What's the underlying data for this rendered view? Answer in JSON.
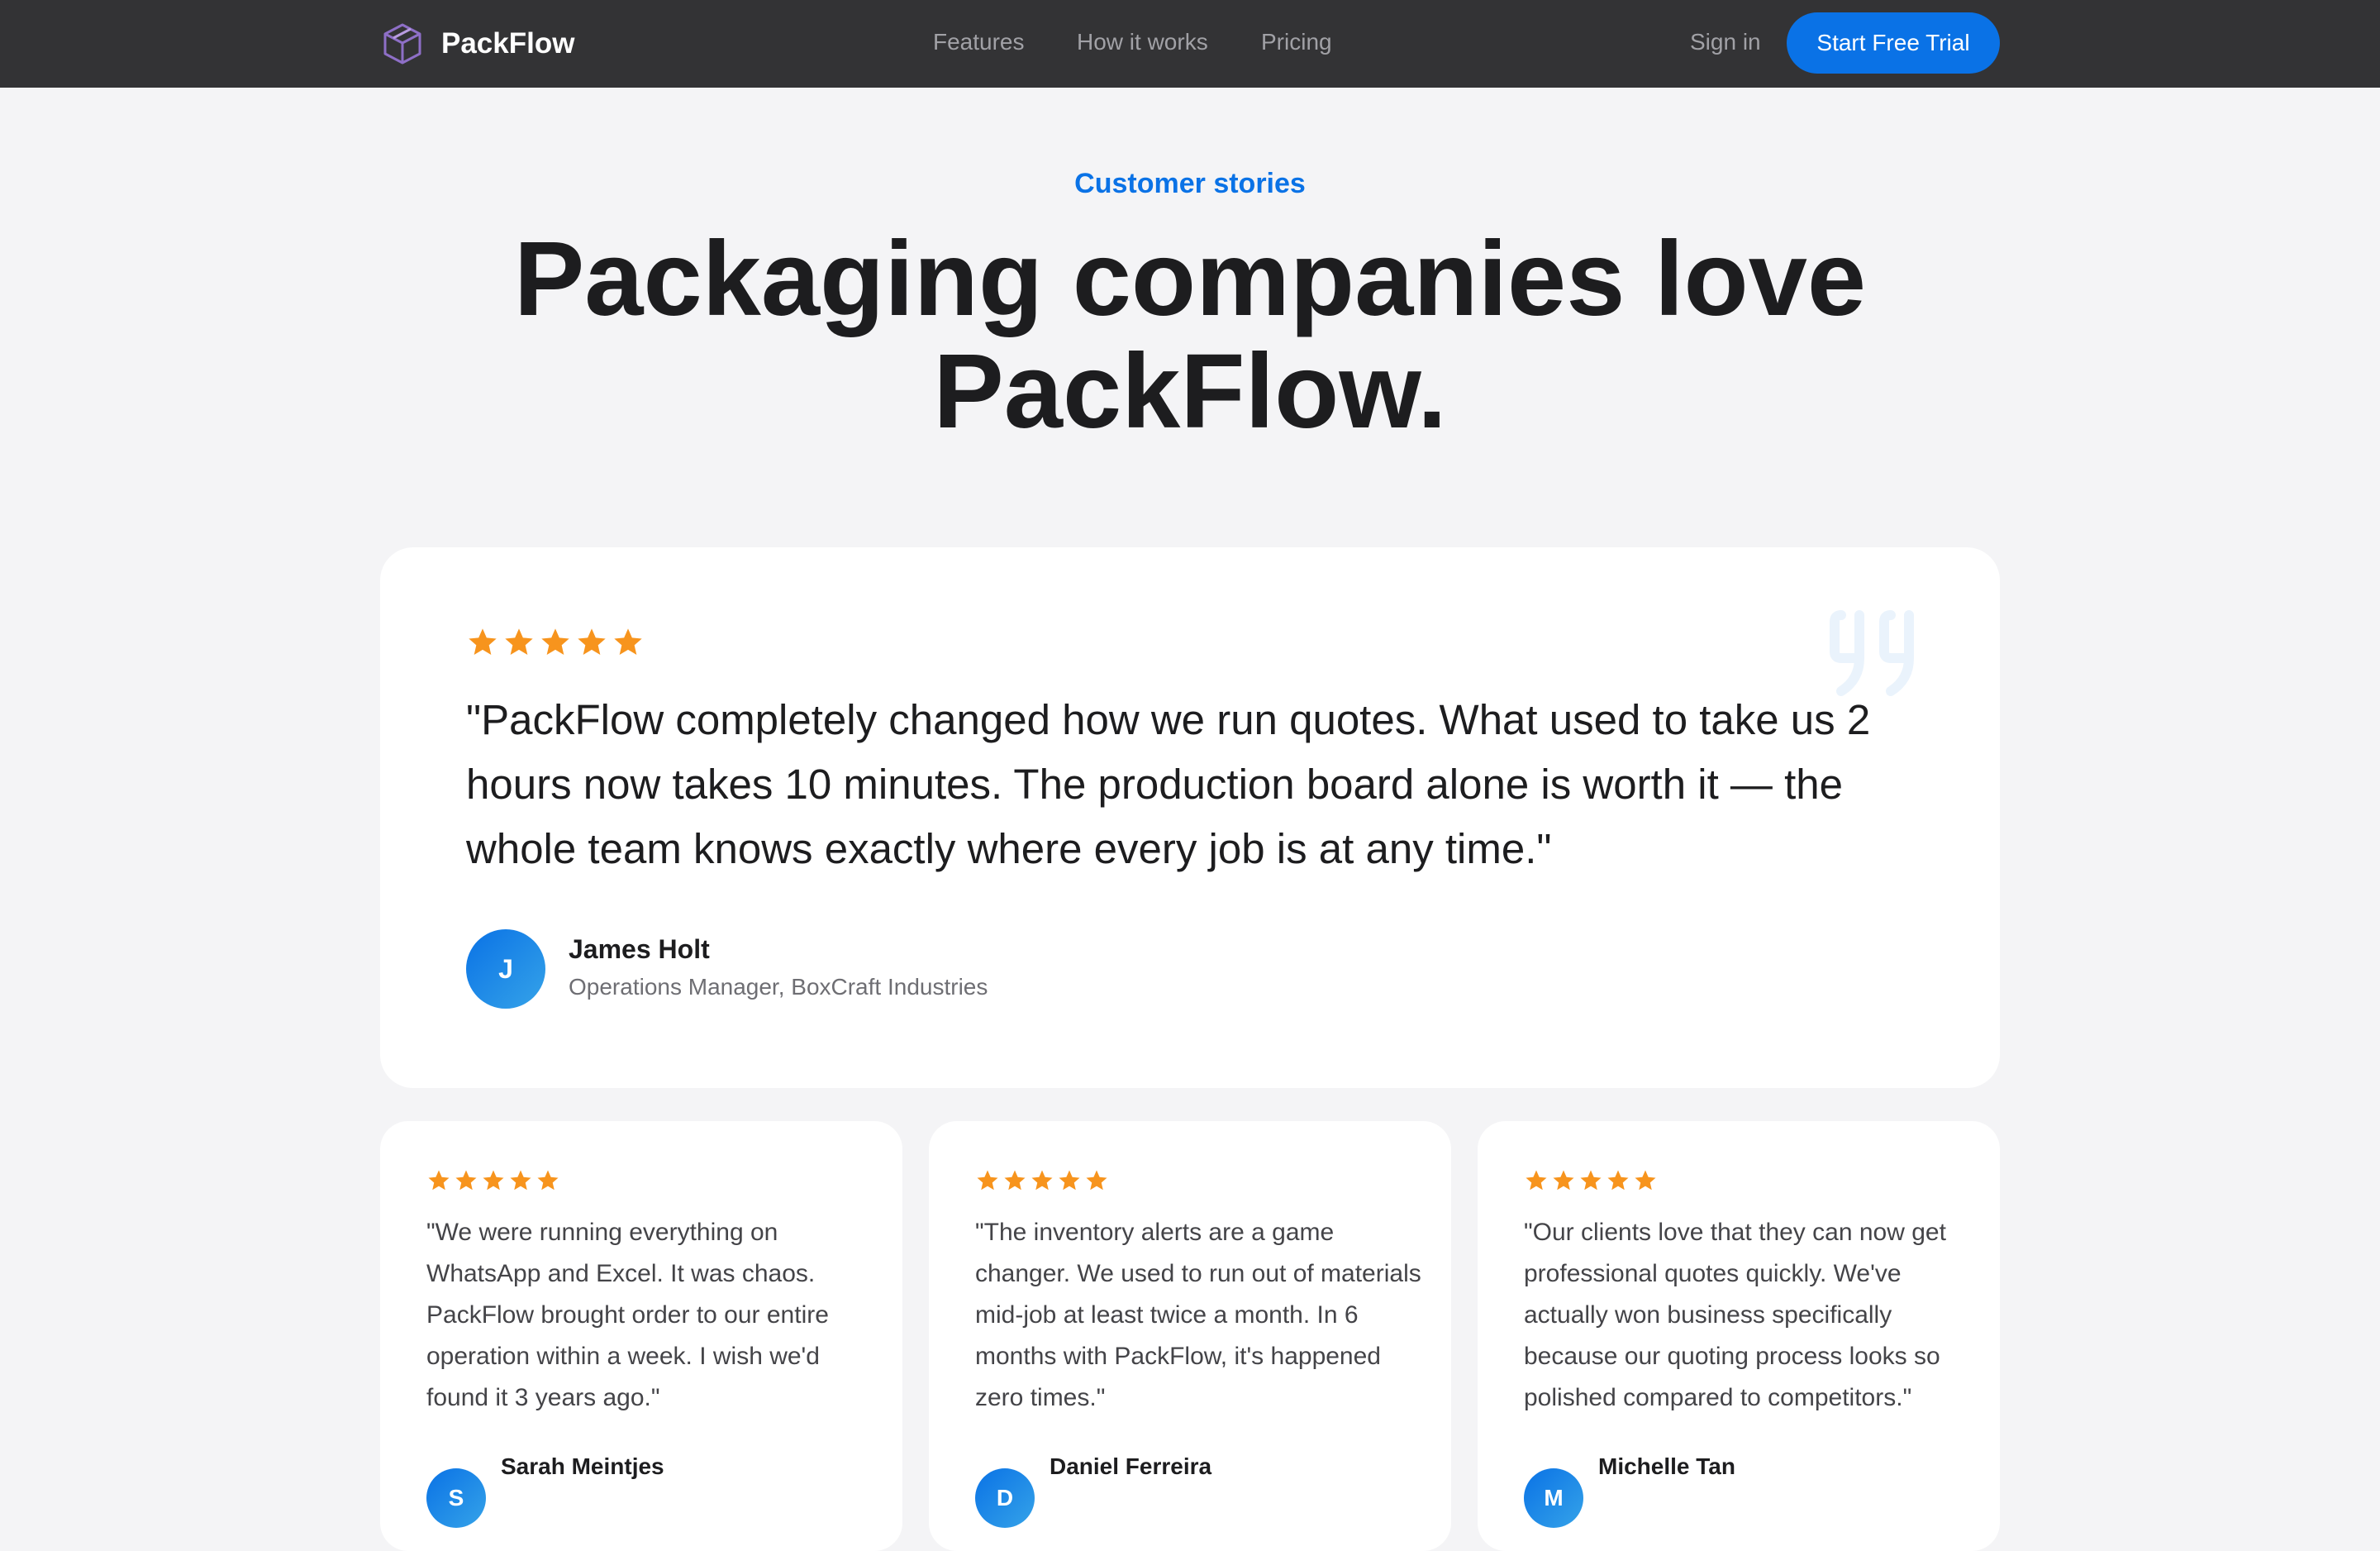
{
  "nav": {
    "logo_text": "PackFlow",
    "links": [
      "Features",
      "How it works",
      "Pricing"
    ],
    "signin": "Sign in",
    "cta": "Start Free Trial"
  },
  "hero": {
    "eyebrow": "Customer stories",
    "headline": "Packaging companies love PackFlow."
  },
  "featured": {
    "stars": 5,
    "quote": "\"PackFlow completely changed how we run quotes. What used to take us 2 hours now takes 10 minutes. The production board alone is worth it — the whole team knows exactly where every job is at any time.\"",
    "avatar_initial": "J",
    "name": "James Holt",
    "role": "Operations Manager, BoxCraft Industries"
  },
  "testimonials": [
    {
      "stars": 5,
      "quote": "\"We were running everything on WhatsApp and Excel. It was chaos. PackFlow brought order to our entire operation within a week. I wish we'd found it 3 years ago.\"",
      "avatar_initial": "S",
      "name": "Sarah Meintjes"
    },
    {
      "stars": 5,
      "quote": "\"The inventory alerts are a game changer. We used to run out of materials mid-job at least twice a month. In 6 months with PackFlow, it's happened zero times.\"",
      "avatar_initial": "D",
      "name": "Daniel Ferreira"
    },
    {
      "stars": 5,
      "quote": "\"Our clients love that they can now get professional quotes quickly. We've actually won business specifically because our quoting process looks so polished compared to competitors.\"",
      "avatar_initial": "M",
      "name": "Michelle Tan"
    }
  ],
  "colors": {
    "accent": "#0a72e6",
    "star": "#f7941d",
    "nav_bg": "#333335",
    "page_bg": "#f4f4f6"
  }
}
